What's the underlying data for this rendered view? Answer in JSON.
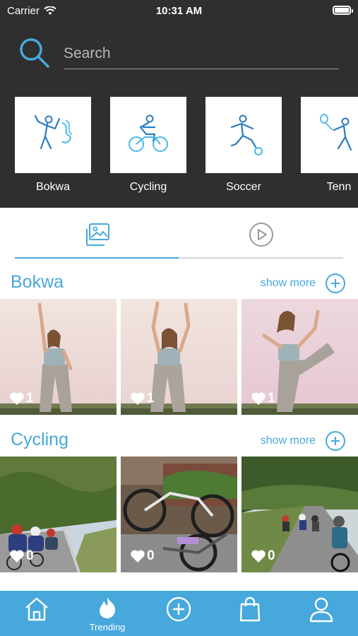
{
  "status": {
    "carrier": "Carrier",
    "time": "10:31 AM"
  },
  "search": {
    "placeholder": "Search"
  },
  "categories": [
    {
      "label": "Bokwa",
      "icon": "bokwa-dancer-icon"
    },
    {
      "label": "Cycling",
      "icon": "cyclist-icon"
    },
    {
      "label": "Soccer",
      "icon": "soccer-player-icon"
    },
    {
      "label": "Tenn",
      "icon": "tennis-player-icon"
    }
  ],
  "tabs": [
    {
      "name": "photos-tab",
      "icon": "images-icon",
      "active": true
    },
    {
      "name": "videos-tab",
      "icon": "play-circle-icon",
      "active": false
    }
  ],
  "sections": [
    {
      "title": "Bokwa",
      "show_more": "show more",
      "items": [
        {
          "likes": "1"
        },
        {
          "likes": "1"
        },
        {
          "likes": "1"
        }
      ]
    },
    {
      "title": "Cycling",
      "show_more": "show more",
      "items": [
        {
          "likes": "0"
        },
        {
          "likes": "0"
        },
        {
          "likes": "0"
        }
      ]
    }
  ],
  "bottom_nav": [
    {
      "icon": "home-icon",
      "label": ""
    },
    {
      "icon": "flame-icon",
      "label": "Trending"
    },
    {
      "icon": "add-circle-icon",
      "label": ""
    },
    {
      "icon": "shopping-bag-icon",
      "label": ""
    },
    {
      "icon": "profile-icon",
      "label": ""
    }
  ],
  "colors": {
    "accent": "#47a8dc",
    "header_bg": "#2f2f2f",
    "text_on_dark": "#ffffff"
  }
}
